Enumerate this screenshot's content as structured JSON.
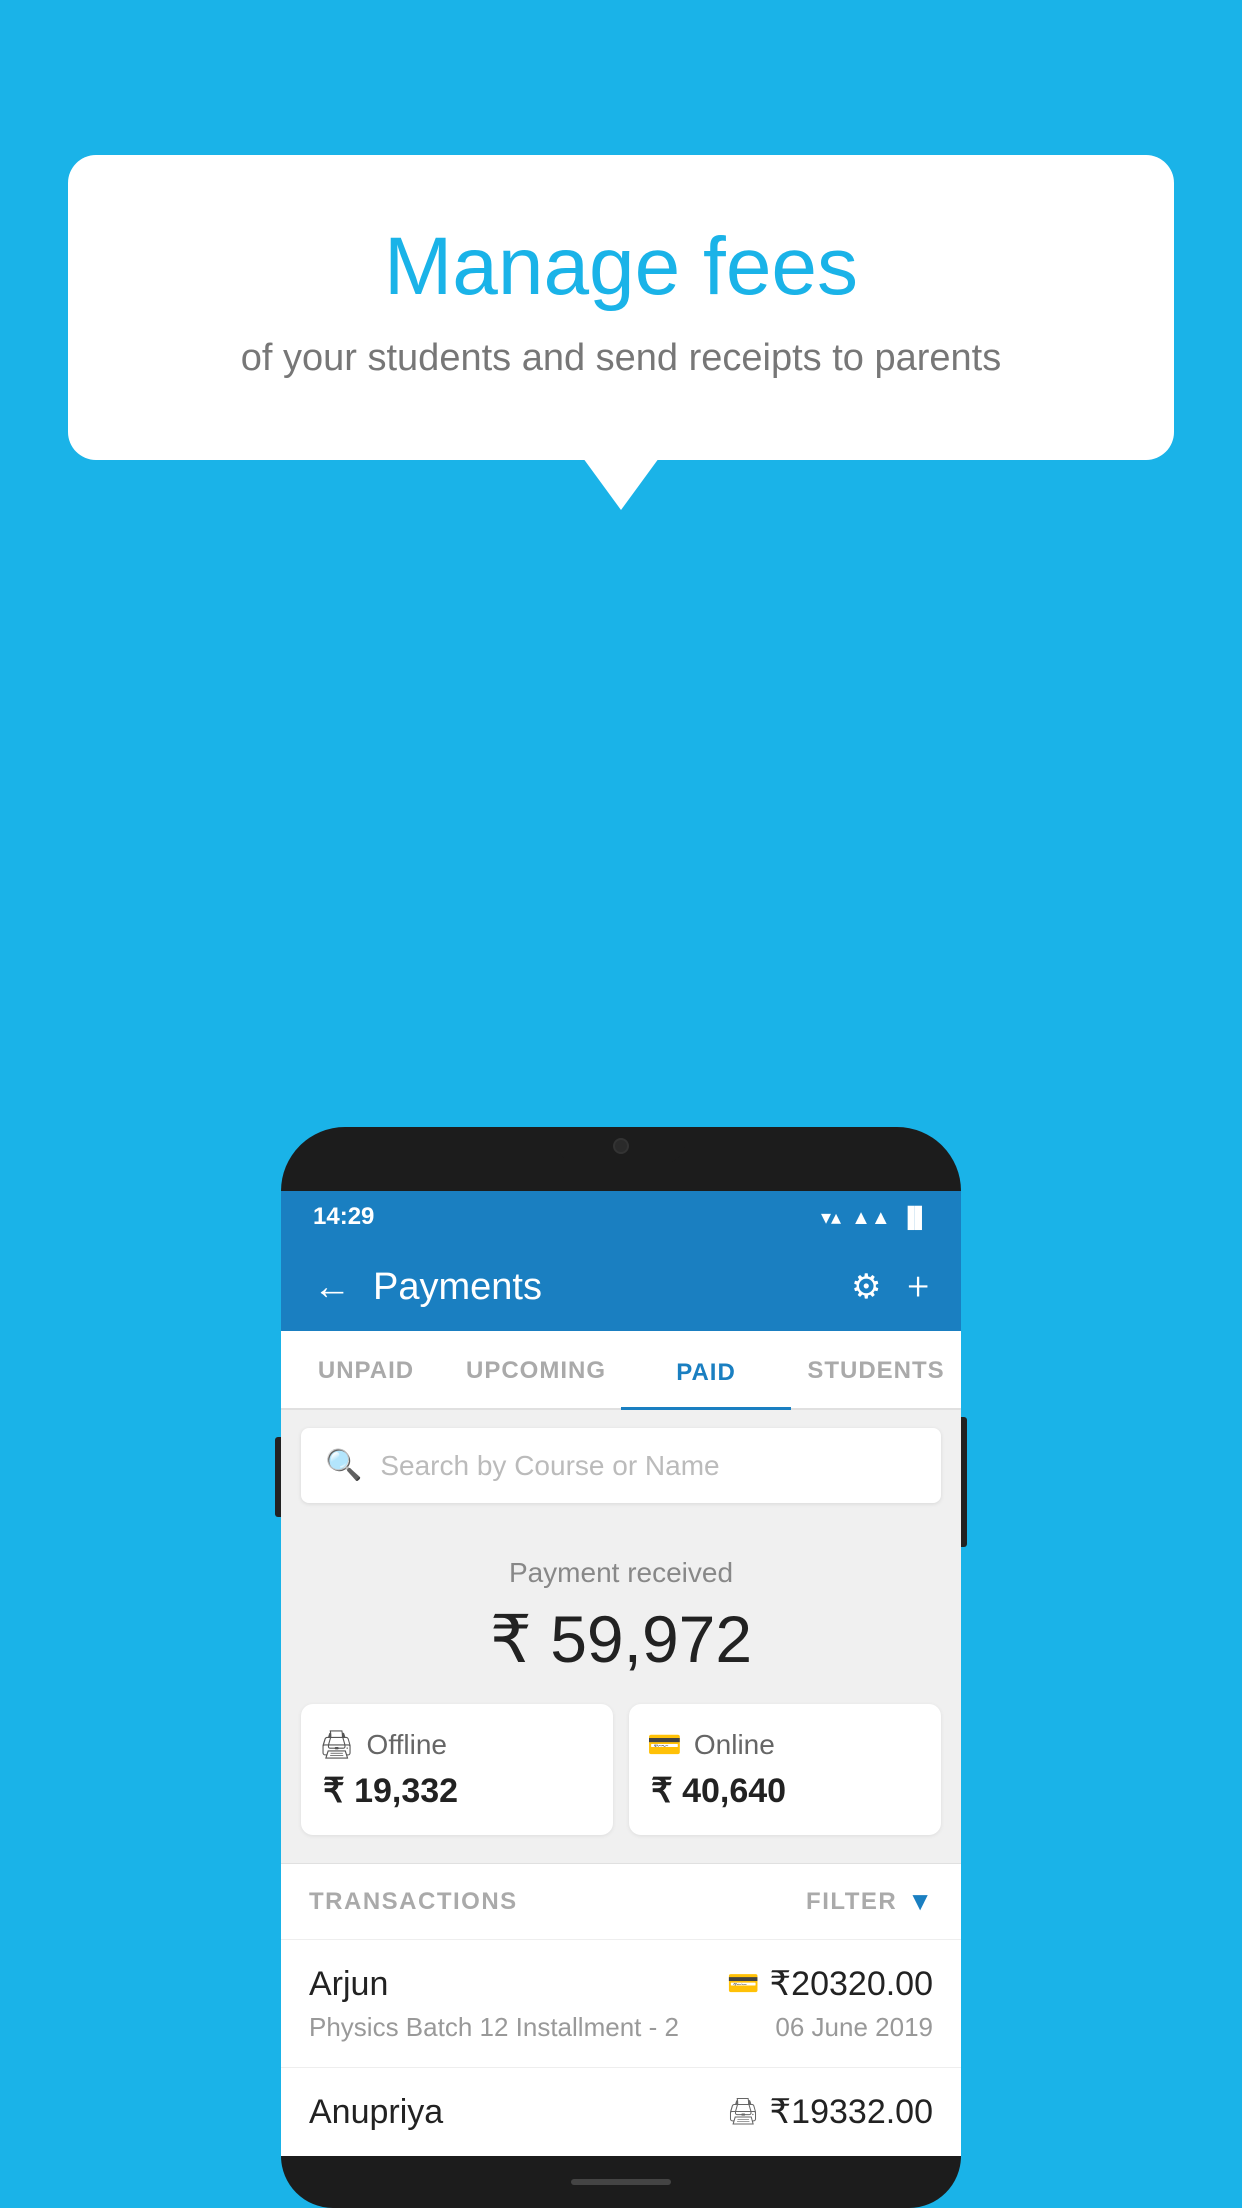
{
  "background_color": "#1ab3e8",
  "bubble": {
    "title": "Manage fees",
    "subtitle": "of your students and send receipts to parents"
  },
  "status_bar": {
    "time": "14:29",
    "wifi_icon": "▼▲",
    "signal_icon": "▲▲",
    "battery_icon": "▐"
  },
  "header": {
    "title": "Payments",
    "back_label": "←",
    "gear_label": "⚙",
    "plus_label": "+"
  },
  "tabs": [
    {
      "label": "UNPAID",
      "active": false
    },
    {
      "label": "UPCOMING",
      "active": false
    },
    {
      "label": "PAID",
      "active": true
    },
    {
      "label": "STUDENTS",
      "active": false
    }
  ],
  "search": {
    "placeholder": "Search by Course or Name"
  },
  "payment_summary": {
    "label": "Payment received",
    "total_amount": "₹ 59,972",
    "offline": {
      "type": "Offline",
      "amount": "₹ 19,332"
    },
    "online": {
      "type": "Online",
      "amount": "₹ 40,640"
    }
  },
  "transactions": {
    "header_label": "TRANSACTIONS",
    "filter_label": "FILTER",
    "items": [
      {
        "name": "Arjun",
        "course": "Physics Batch 12 Installment - 2",
        "amount": "₹20320.00",
        "date": "06 June 2019",
        "type": "online"
      },
      {
        "name": "Anupriya",
        "course": "",
        "amount": "₹19332.00",
        "date": "",
        "type": "offline"
      }
    ]
  }
}
